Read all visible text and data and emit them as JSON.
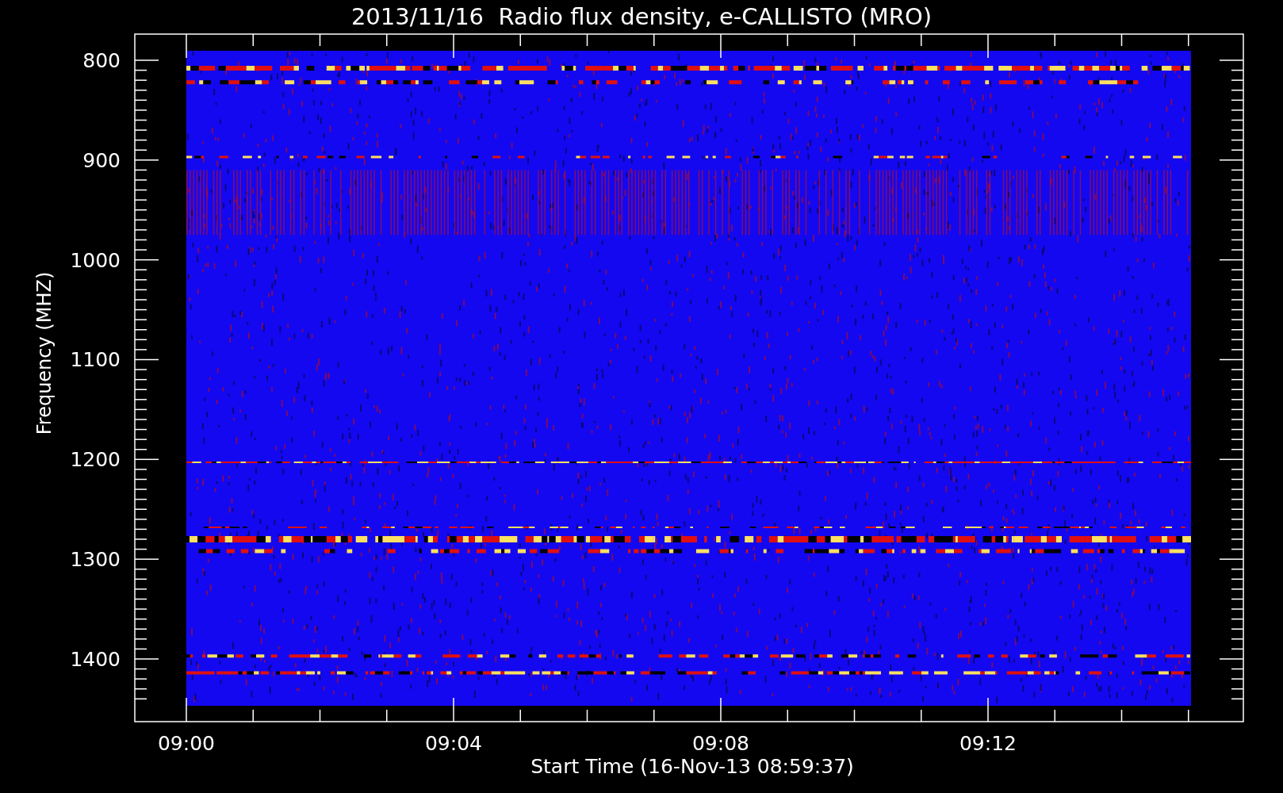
{
  "title": "2013/11/16  Radio flux density, e-CALLISTO (MRO)",
  "y_axis": {
    "label": "Frequency (MHZ)",
    "ticks": [
      "800",
      "900",
      "1000",
      "1100",
      "1200",
      "1300",
      "1400"
    ]
  },
  "x_axis": {
    "label": "Start Time (16-Nov-13 08:59:37)",
    "ticks": [
      "09:00",
      "09:04",
      "09:08",
      "09:12"
    ]
  }
}
